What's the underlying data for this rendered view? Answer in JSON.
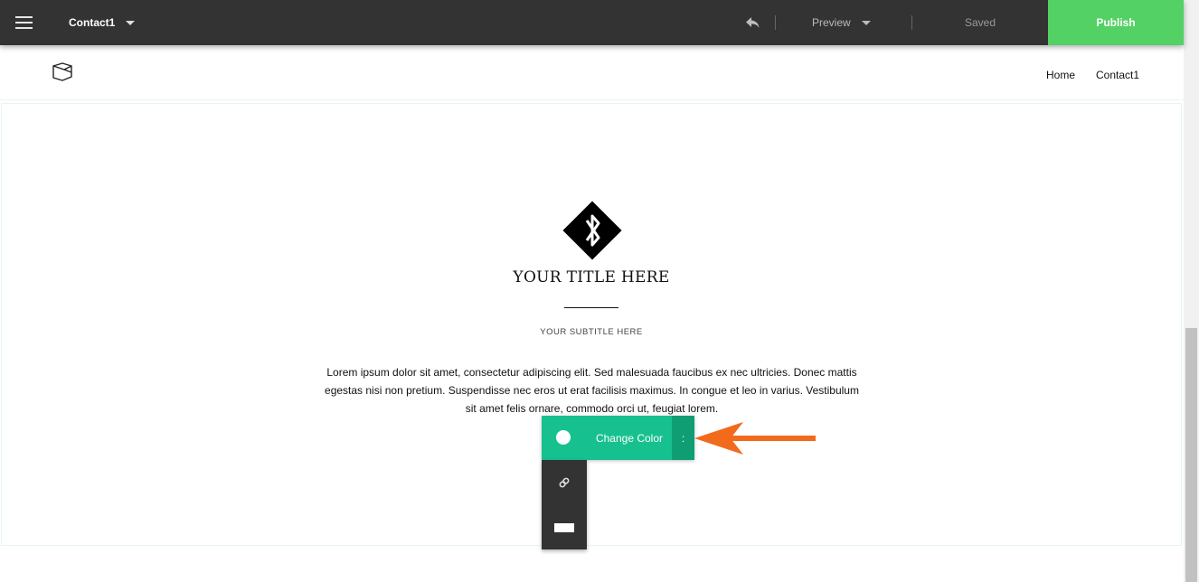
{
  "toolbar": {
    "page_name": "Contact1",
    "preview_label": "Preview",
    "saved_status": "Saved",
    "publish_label": "Publish",
    "icons": [
      "hamburger-menu-icon",
      "chevron-down-icon",
      "undo-icon"
    ]
  },
  "site_nav": {
    "links": [
      "Home",
      "Contact1"
    ]
  },
  "hero": {
    "title": "YOUR TITLE HERE",
    "subtitle": "YOUR SUBTITLE HERE",
    "body": "Lorem ipsum dolor sit amet, consectetur adipiscing elit. Sed malesuada faucibus ex nec ultricies. Donec mattis egestas nisi non pretium. Suspendisse nec eros ut erat facilisis maximus. In congue et leo in varius. Vestibulum sit amet felis ornare, commodo orci ut, feugiat lorem."
  },
  "editor": {
    "change_color_label": "Change Color",
    "more_label": ":",
    "accent_color": "#17c18f",
    "icons": [
      "color-swatch-icon",
      "link-icon",
      "block-icon"
    ]
  },
  "colors": {
    "publish": "#53d165",
    "annotation_arrow": "#f26a1b",
    "topbar": "#333333"
  }
}
